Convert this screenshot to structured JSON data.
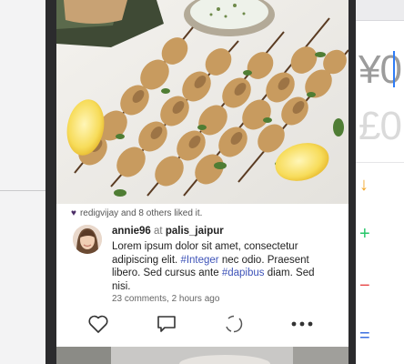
{
  "post": {
    "likes_text": "redigvijay and 8 others liked it.",
    "username": "annie96",
    "at": "at",
    "place": "palis_jaipur",
    "caption": {
      "part1": "Lorem ipsum dolor sit amet, consectetur adipiscing elit. ",
      "tag1": "#Integer",
      "part2": " nec odio. Praesent libero. Sed cursus ante ",
      "tag2": "#dapibus",
      "part3": " diam. Sed nisi."
    },
    "meta": "23 comments, 2 hours ago"
  },
  "icons": {
    "like": "heart-outline-icon",
    "comment": "comment-bubble-icon",
    "share": "share-circle-icon",
    "more": "more-dots-icon",
    "liked": "heart-filled-icon"
  },
  "background_app": {
    "digit_top": "¥0",
    "digit_bottom": "£0",
    "ops": {
      "arrow": "↓",
      "plus": "+",
      "minus": "−",
      "equals": "="
    }
  },
  "colors": {
    "heart_small": "#4b2c66",
    "hashtag": "#3e53b8",
    "frame": "#2b2b2d"
  }
}
